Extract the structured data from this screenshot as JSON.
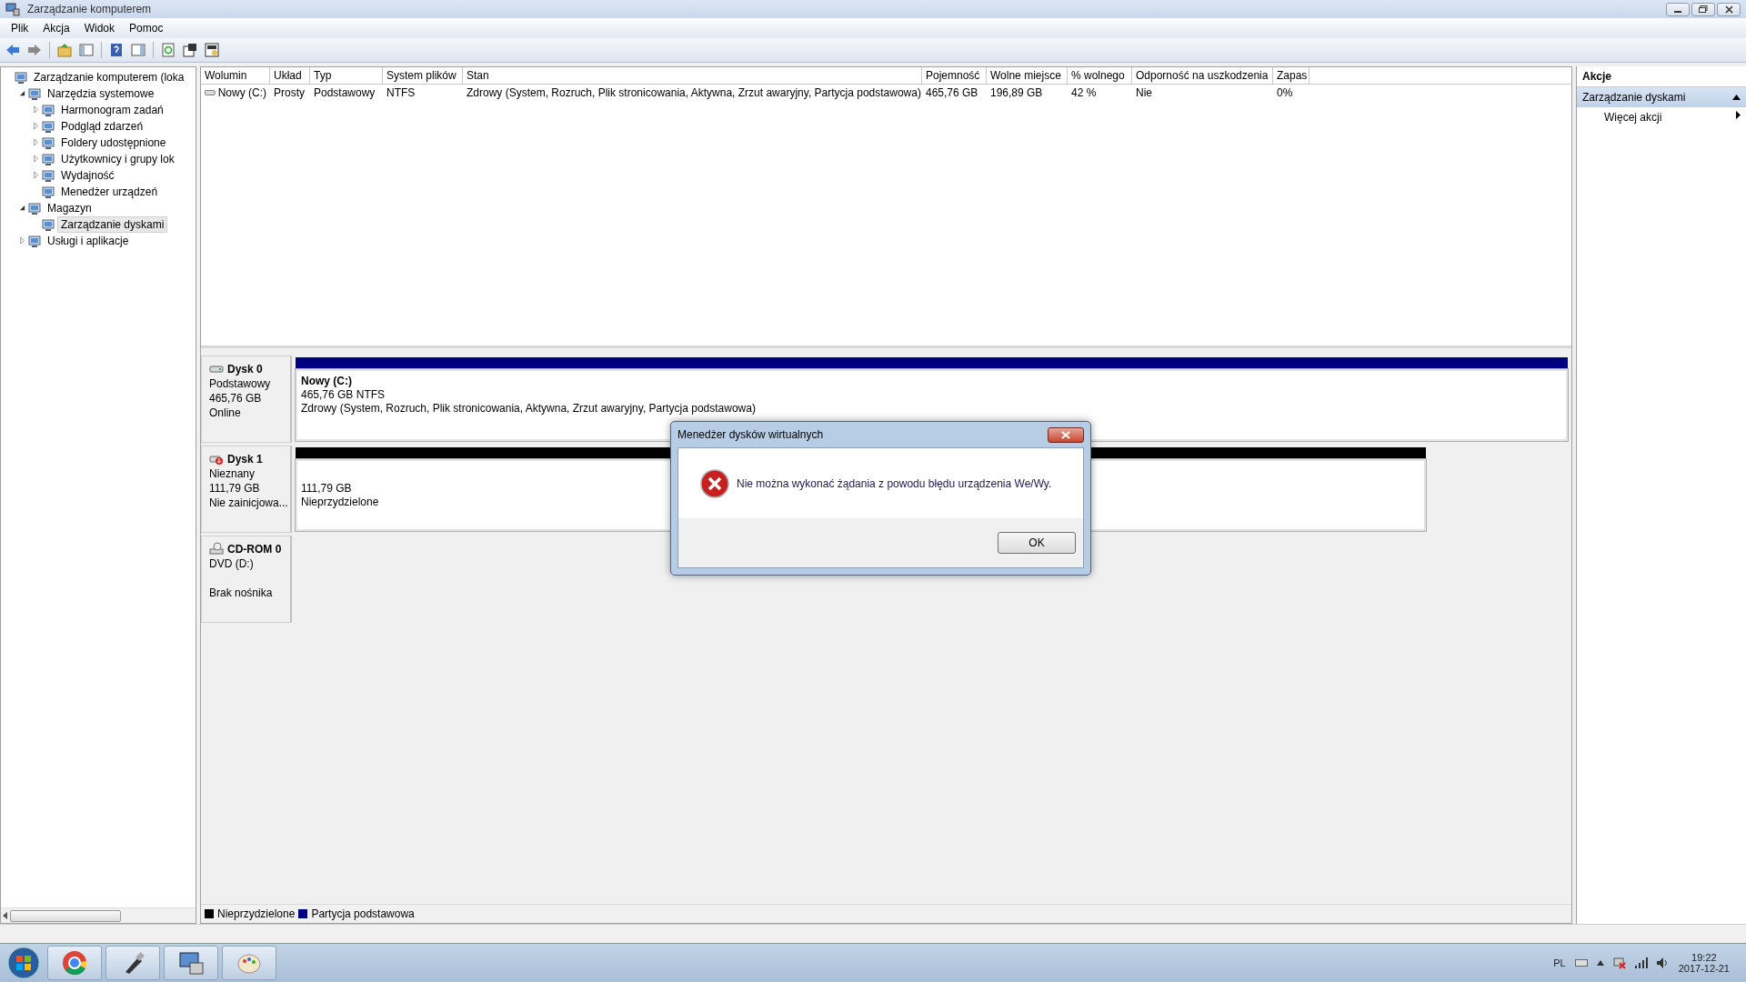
{
  "window": {
    "title": "Zarządzanie komputerem"
  },
  "menu": [
    "Plik",
    "Akcja",
    "Widok",
    "Pomoc"
  ],
  "tree": [
    {
      "label": "Zarządzanie komputerem (loka",
      "selected": false,
      "children": [
        {
          "label": "Narzędzia systemowe",
          "expanded": true,
          "selected": false,
          "children": [
            {
              "label": "Harmonogram zadań",
              "expanded": false,
              "selected": false
            },
            {
              "label": "Podgląd zdarzeń",
              "expanded": false,
              "selected": false
            },
            {
              "label": "Foldery udostępnione",
              "expanded": false,
              "selected": false
            },
            {
              "label": "Użytkownicy i grupy lok",
              "expanded": false,
              "selected": false
            },
            {
              "label": "Wydajność",
              "expanded": false,
              "selected": false
            },
            {
              "label": "Menedżer urządzeń",
              "selected": false
            }
          ]
        },
        {
          "label": "Magazyn",
          "expanded": true,
          "selected": false,
          "children": [
            {
              "label": "Zarządzanie dyskami",
              "selected": true
            }
          ]
        },
        {
          "label": "Usługi i aplikacje",
          "expanded": false,
          "selected": false
        }
      ]
    }
  ],
  "table": {
    "columns": [
      "Wolumin",
      "Układ",
      "Typ",
      "System plików",
      "Stan",
      "Pojemność",
      "Wolne miejsce",
      "% wolnego",
      "Odporność na uszkodzenia",
      "Zapas"
    ],
    "rows": [
      {
        "cells": [
          "Nowy (C:)",
          "Prosty",
          "Podstawowy",
          "NTFS",
          "Zdrowy (System, Rozruch, Plik stronicowania, Aktywna, Zrzut awaryjny, Partycja podstawowa)",
          "465,76 GB",
          "196,89 GB",
          "42 %",
          "Nie",
          "0%"
        ]
      }
    ]
  },
  "disks": [
    {
      "kind": "disk",
      "name": "Dysk 0",
      "type": "Podstawowy",
      "size": "465,76 GB",
      "status": "Online",
      "partition": {
        "color": "#000080",
        "title": "Nowy  (C:)",
        "lines": [
          "465,76 GB NTFS",
          "Zdrowy (System, Rozruch, Plik stronicowania, Aktywna, Zrzut awaryjny, Partycja podstawowa)"
        ]
      }
    },
    {
      "kind": "unknown",
      "name": "Dysk 1",
      "type": "Nieznany",
      "size": "111,79 GB",
      "status": "Nie zainicjowa...",
      "partition": {
        "color": "#000000",
        "lines": [
          "111,79 GB",
          "Nieprzydzielone"
        ]
      }
    },
    {
      "kind": "cdrom",
      "name": "CD-ROM 0",
      "type": "DVD (D:)",
      "status": "Brak nośnika"
    }
  ],
  "legend": [
    {
      "label": "Nieprzydzielone",
      "color": "#000000"
    },
    {
      "label": "Partycja podstawowa",
      "color": "#000080"
    }
  ],
  "actions": {
    "title": "Akcje",
    "section": {
      "label": "Zarządzanie dyskami",
      "expanded": true
    },
    "items": [
      "Więcej akcji"
    ]
  },
  "dialog": {
    "title": "Menedżer dysków wirtualnych",
    "message": "Nie można wykonać żądania z powodu błędu urządzenia We/Wy.",
    "button": "OK"
  },
  "tray": {
    "language": "PL",
    "time": "19:22",
    "date": "2017-12-21"
  }
}
